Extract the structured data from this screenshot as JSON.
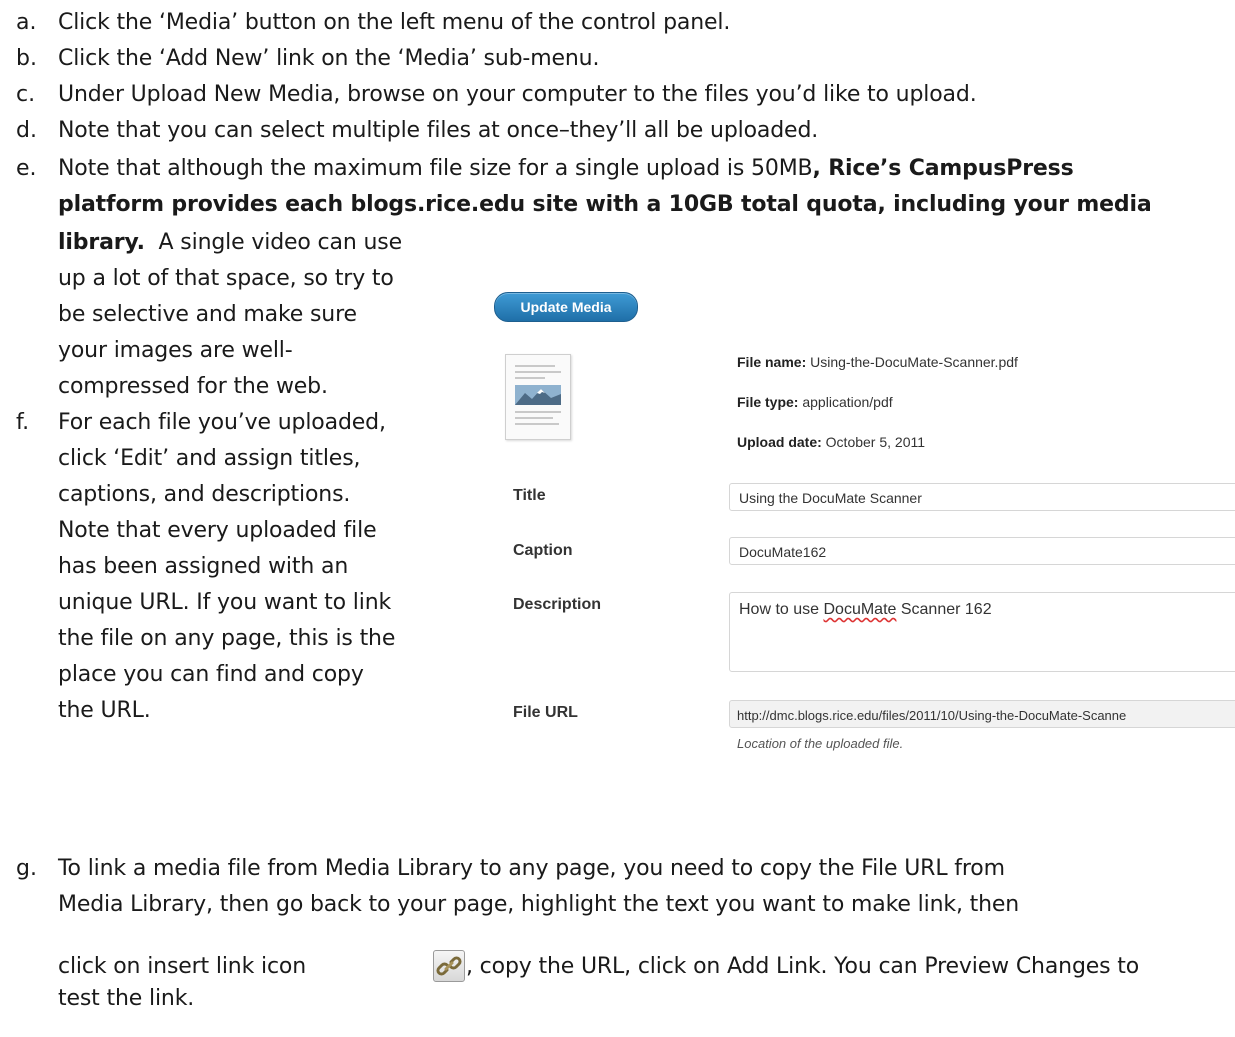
{
  "steps": {
    "a": {
      "marker": "a.",
      "text": "Click the ‘Media’ button on the left menu of the control panel."
    },
    "b": {
      "marker": "b.",
      "text": "Click the ‘Add New’ link on the ‘Media’ sub-menu."
    },
    "c": {
      "marker": "c.",
      "text": "Under Upload New Media, browse on your computer to the files you’d like to upload."
    },
    "d": {
      "marker": "d.",
      "text": "Note that you can select multiple files at once–they’ll all be uploaded."
    },
    "e": {
      "marker": "e.",
      "text_1": "Note that although the maximum file size for a single upload is 50MB",
      "bold_1": ", Rice’s CampusPress",
      "bold_2": "platform provides each blogs.rice.edu site with a 10GB total quota, including your media",
      "bold_3": "library.",
      "lines": [
        "A single video can use",
        "up a lot of that space, so try to",
        "be selective and make sure",
        "your images are well-",
        "compressed for the web."
      ]
    },
    "f": {
      "marker": "f.",
      "lines": [
        "For each file you’ve uploaded,",
        "click ‘Edit’ and assign titles,",
        "captions, and descriptions.",
        "Note that every uploaded file",
        "has been assigned with an",
        "unique URL. If you want to link",
        "the file on any page, this is the",
        "place you can find and copy",
        "the URL."
      ]
    },
    "g": {
      "marker": "g.",
      "line_1": "To link a media file from Media Library to any page, you need to copy the File URL from",
      "line_2": "Media Library, then go back to your page, highlight the text you want to make link, then",
      "line_3a": "click on insert link icon",
      "line_3b": ", copy the URL, click on Add Link. You can Preview Changes to",
      "line_4": "test the link."
    }
  },
  "media_panel": {
    "update_button": "Update Media",
    "file_name_label": "File name:",
    "file_name": "Using-the-DocuMate-Scanner.pdf",
    "file_type_label": "File type:",
    "file_type": "application/pdf",
    "upload_date_label": "Upload date:",
    "upload_date": "October 5, 2011",
    "title_label": "Title",
    "title_value": "Using the DocuMate Scanner",
    "caption_label": "Caption",
    "caption_value": "DocuMate162",
    "description_label": "Description",
    "description_pre": "How to use ",
    "description_spell": "DocuMate",
    "description_post": " Scanner 162",
    "file_url_label": "File URL",
    "file_url_value": "http://dmc.blogs.rice.edu/files/2011/10/Using-the-DocuMate-Scanne",
    "file_url_hint": "Location of the uploaded file."
  },
  "icons": {
    "link_icon": "chain-link-icon",
    "document_icon": "pdf-document-thumbnail-icon"
  },
  "colors": {
    "button_top": "#3f9bd5",
    "button_bottom": "#1f6fa8",
    "spellcheck": "#dd3333"
  }
}
